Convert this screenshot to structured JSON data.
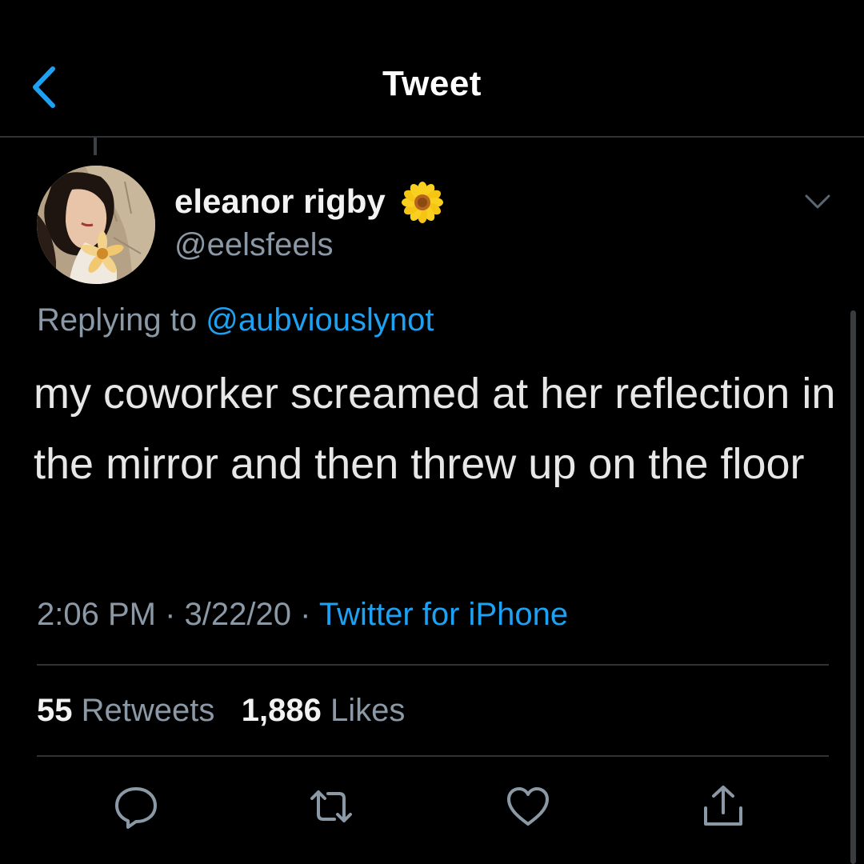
{
  "header": {
    "title": "Tweet"
  },
  "tweet": {
    "display_name": "eleanor rigby",
    "handle": "@eelsfeels",
    "replying_prefix": "Replying to",
    "reply_to": "@aubviouslynot",
    "text": "my coworker screamed at her reflection in the mirror and then threw up on the floor",
    "time": "2:06 PM",
    "separator": "·",
    "date": "3/22/20",
    "source": "Twitter for iPhone"
  },
  "stats": {
    "retweets_count": "55",
    "retweets_label": "Retweets",
    "likes_count": "1,886",
    "likes_label": "Likes"
  },
  "icons": {
    "back": "chevron-left-icon",
    "more": "chevron-down-icon",
    "badge": "sunflower-icon",
    "reply": "comment-icon",
    "retweet": "retweet-icon",
    "like": "heart-icon",
    "share": "share-icon"
  },
  "colors": {
    "background": "#000000",
    "accent": "#1da1f2",
    "secondary_text": "#8b98a5",
    "primary_text": "#e7e7e7",
    "divider": "#2f3336"
  }
}
